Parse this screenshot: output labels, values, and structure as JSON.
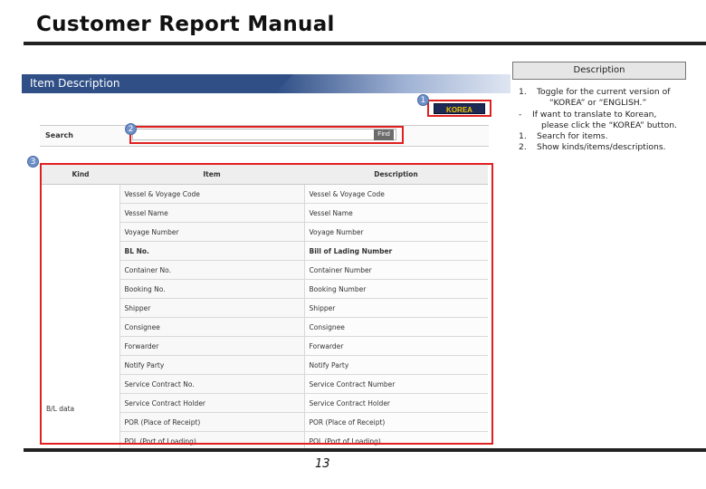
{
  "page": {
    "title": "Customer Report Manual",
    "page_number": "13"
  },
  "screenshot": {
    "panel_title": "Item Description",
    "korea_button": "KOREA",
    "search_label": "Search",
    "find_button": "Find",
    "markers": [
      "1",
      "2",
      "3"
    ],
    "table": {
      "headers": [
        "Kind",
        "Item",
        "Description"
      ],
      "kind_value": "B/L data",
      "rows": [
        {
          "item": "Vessel & Voyage Code",
          "description": "Vessel & Voyage Code"
        },
        {
          "item": "Vessel Name",
          "description": "Vessel Name"
        },
        {
          "item": "Voyage Number",
          "description": "Voyage Number"
        },
        {
          "item": "BL No.",
          "description": "Bill of Lading Number"
        },
        {
          "item": "Container No.",
          "description": "Container Number"
        },
        {
          "item": "Booking No.",
          "description": "Booking Number"
        },
        {
          "item": "Shipper",
          "description": "Shipper"
        },
        {
          "item": "Consignee",
          "description": "Consignee"
        },
        {
          "item": "Forwarder",
          "description": "Forwarder"
        },
        {
          "item": "Notify Party",
          "description": "Notify Party"
        },
        {
          "item": "Service Contract No.",
          "description": "Service Contract Number"
        },
        {
          "item": "Service Contract Holder",
          "description": "Service Contract Holder"
        },
        {
          "item": "POR (Place of Receipt)",
          "description": "POR (Place of Receipt)"
        },
        {
          "item": "POL (Port of Loading)",
          "description": "POL (Port of Loading)"
        }
      ]
    }
  },
  "description_panel": {
    "header": "Description",
    "line1_num": "1.",
    "line1": "Toggle for the current version of",
    "line1b": "“KOREA” or “ENGLISH.”",
    "line2_num": "-",
    "line2": "If want to translate to Korean,",
    "line2b": "please click the “KOREA” button.",
    "line3_num": "1.",
    "line3": "Search for items.",
    "line4_num": "2.",
    "line4": "Show kinds/items/descriptions."
  }
}
